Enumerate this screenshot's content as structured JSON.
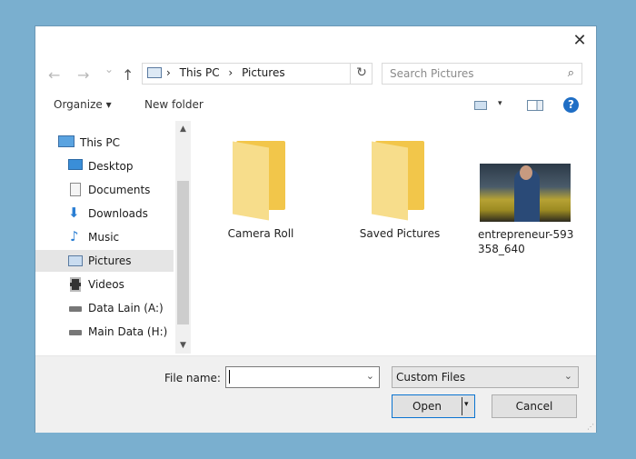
{
  "window": {
    "close_glyph": "✕"
  },
  "navigation": {
    "back_glyph": "←",
    "forward_glyph": "→",
    "recent_glyph": "⌄",
    "up_glyph": "↑"
  },
  "address": {
    "separator": "›",
    "crumbs": [
      "This PC",
      "Pictures"
    ],
    "refresh_glyph": "↻"
  },
  "search": {
    "placeholder": "Search Pictures",
    "icon_glyph": "⌕"
  },
  "toolbar": {
    "organize_label": "Organize ▾",
    "new_folder_label": "New folder",
    "view_arrow": "▾",
    "help_glyph": "?"
  },
  "sidebar": {
    "items": [
      {
        "label": "This PC",
        "icon": "computer-icon"
      },
      {
        "label": "Desktop",
        "icon": "desktop-icon"
      },
      {
        "label": "Documents",
        "icon": "documents-icon"
      },
      {
        "label": "Downloads",
        "icon": "downloads-icon"
      },
      {
        "label": "Music",
        "icon": "music-icon"
      },
      {
        "label": "Pictures",
        "icon": "pictures-icon",
        "selected": true
      },
      {
        "label": "Videos",
        "icon": "videos-icon"
      },
      {
        "label": "Data Lain (A:)",
        "icon": "drive-icon"
      },
      {
        "label": "Main Data (H:)",
        "icon": "drive-icon"
      }
    ],
    "scroll_up": "▲",
    "scroll_down": "▼"
  },
  "files": [
    {
      "name": "Camera Roll",
      "type": "folder"
    },
    {
      "name": "Saved Pictures",
      "type": "folder"
    },
    {
      "name": "entrepreneur-593\n358_640",
      "type": "image"
    }
  ],
  "footer": {
    "file_name_label": "File name:",
    "file_name_value": "",
    "dropdown_glyph": "⌄",
    "filter_value": "Custom Files",
    "open_label": "Open",
    "open_arrow": "▾",
    "cancel_label": "Cancel"
  },
  "colors": {
    "background": "#7aafcf",
    "accent": "#0a74d1",
    "folder": "#f2c64a",
    "selection": "#e5e5e5"
  }
}
